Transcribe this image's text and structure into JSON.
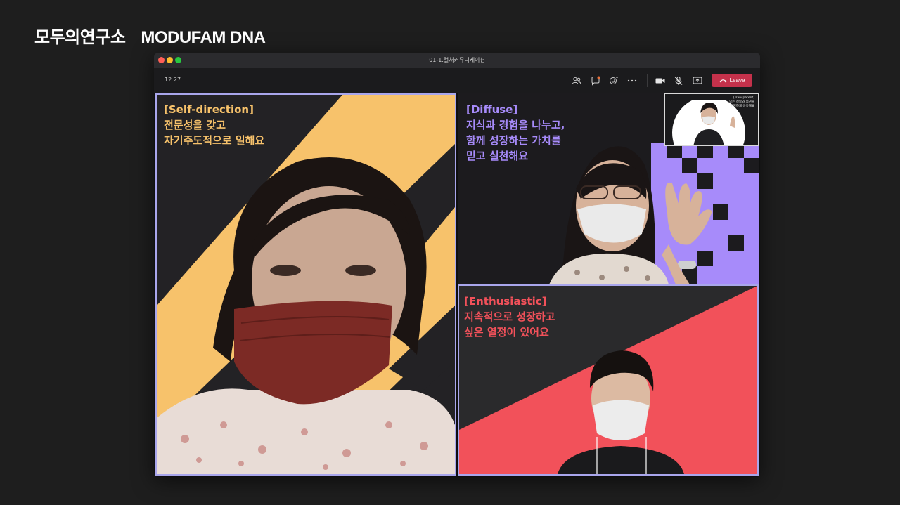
{
  "page": {
    "title_korean": "모두의연구소",
    "title_english": "MODUFAM DNA"
  },
  "window": {
    "title": "01-1.컬처커뮤니케이션",
    "clock": "12:27",
    "leave_label": "Leave"
  },
  "tiles": {
    "self_direction": {
      "heading": "[Self-direction]",
      "line1": "전문성을 갖고",
      "line2": "자기주도적으로 일해요"
    },
    "diffuse": {
      "heading": "[Diffuse]",
      "line1": "지식과 경험을 나누고,",
      "line2": "함께 성장하는 가치를",
      "line3": "믿고 실천해요"
    },
    "enthusiastic": {
      "heading": "[Enthusiastic]",
      "line1": "지속적으로 성장하고",
      "line2": "싶은 열정이 있어요"
    },
    "transparent_pip": {
      "heading": "[Transparent]",
      "line1": "모든 정보와 의견을",
      "line2": "투명하게 공유해요"
    }
  },
  "colors": {
    "self_direction": "#f7c26b",
    "diffuse": "#a78bfa",
    "enthusiastic": "#f2515a",
    "tile_border": "#a9a6ec",
    "leave_button": "#c4314b"
  },
  "icons": {
    "participants": "people-icon",
    "chat": "chat-icon",
    "reactions": "reactions-icon",
    "more": "more-icon",
    "camera": "camera-icon",
    "mic": "mic-muted-icon",
    "share": "share-screen-icon",
    "leave": "phone-hangup-icon"
  }
}
